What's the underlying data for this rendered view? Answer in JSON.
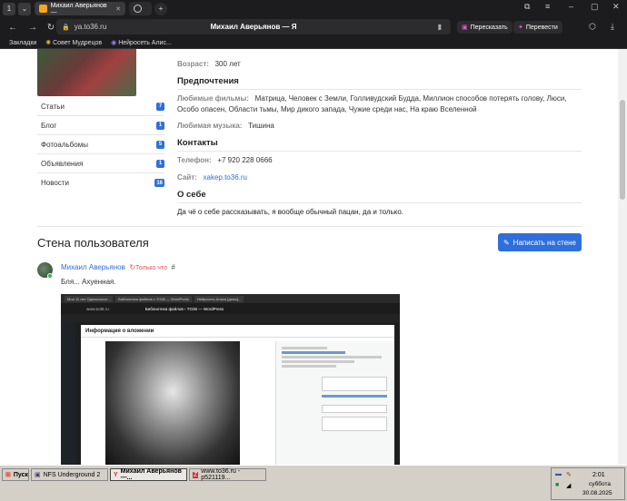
{
  "browser": {
    "profile_badge": "1",
    "tabs": [
      {
        "title": "Михаил Аверьянов —"
      },
      {
        "title": ""
      }
    ],
    "new_tab": "+",
    "url": "ya.to36.ru",
    "page_title": "Михаил Аверьянов — Я",
    "retell_label": "Пересказать",
    "translate_label": "Перевести",
    "bookmarks": [
      "Закладки",
      "Совет Мудрецов",
      "Нейросеть Алис..."
    ]
  },
  "sidebar": {
    "items": [
      {
        "label": "Статьи",
        "count": "7"
      },
      {
        "label": "Блог",
        "count": "1"
      },
      {
        "label": "Фотоальбомы",
        "count": "5"
      },
      {
        "label": "Объявления",
        "count": "1"
      },
      {
        "label": "Новости",
        "count": "16"
      }
    ]
  },
  "profile": {
    "age_label": "Возраст:",
    "age_value": "300 лет",
    "prefs_heading": "Предпочтения",
    "films_label": "Любимые фильмы:",
    "films_value": "Матрица, Человек с Земли, Голливудский Будда, Миллион способов потерять голову, Люси, Особо опасен, Области тьмы, Мир дикого запада, Чужие среди нас, На краю Вселенной",
    "music_label": "Любимая музыка:",
    "music_value": "Тишина",
    "contacts_heading": "Контакты",
    "phone_label": "Телефон:",
    "phone_value": "+7 920 228 0666",
    "site_label": "Сайт:",
    "site_value": "xakep.to36.ru",
    "about_heading": "О себе",
    "about_text": "Да чё о себе рассказывать, я вообще обычный пацан, да и только."
  },
  "wall": {
    "title": "Стена пользователя",
    "write_button": "Написать на стене",
    "post": {
      "author": "Михаил Аверьянов",
      "time": "Только что",
      "hash": "#",
      "text": "Бля... Ахуенная."
    }
  },
  "embedded": {
    "tab1": "Мои 11 лет Одноклассн...",
    "tab2": "Библиотека файлов с TO36 — WordPress",
    "tab3": "Нейросеть Алиса [демо]...",
    "url": "www.to36.ru",
    "title": "Библиотека файлов ‹ TO36 — WordPress",
    "dialog_title": "Информация о вложении"
  },
  "taskbar": {
    "start": "Пуск",
    "items": [
      "NFS Underground 2",
      "Михаил Аверьянов —...",
      "www.to36.ru - p521119..."
    ],
    "time": "2:01",
    "day": "суббота",
    "date": "30.08.2025"
  },
  "colors": {
    "accent": "#2f6fdc",
    "chrome": "#1c1c1e"
  }
}
